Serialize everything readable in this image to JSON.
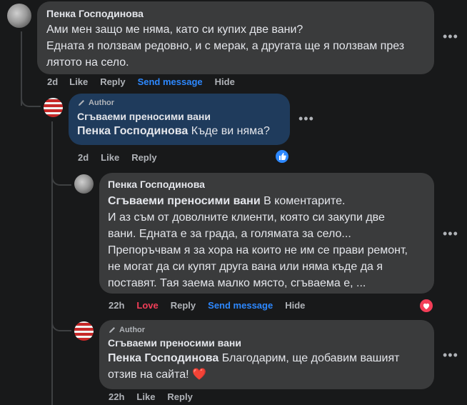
{
  "comment1": {
    "author": "Пенка Господинова",
    "line1": "Ами мен защо ме няма, като си купих две вани?",
    "line2": "Едната я ползвам редовно, и с мерак, а другата ще я ползвам през",
    "line3": "лятото на село.",
    "time": "2d",
    "like": "Like",
    "reply": "Reply",
    "send": "Send message",
    "hide": "Hide"
  },
  "reply1": {
    "badge": "Author",
    "page": "Сгъваеми преносими вани",
    "mention": "Пенка Господинова",
    "text": " Къде ви няма?",
    "time": "2d",
    "like": "Like",
    "reply": "Reply"
  },
  "reply2": {
    "author": "Пенка Господинова",
    "mention": "Сгъваеми преносими вани",
    "line1": " В коментарите.",
    "line2": "И аз съм от доволните клиенти, която си закупи две",
    "line3": "вани. Едната е за града, а голямата за село...",
    "line4": "Препоръчвам я за хора на които не им се прави ремонт,",
    "line5": "не могат да си купят друга вана или няма къде да я",
    "line6": "поставят. Тая заема малко място, сгъваема е, ...",
    "time": "22h",
    "love": "Love",
    "reply": "Reply",
    "send": "Send message",
    "hide": "Hide"
  },
  "reply3": {
    "badge": "Author",
    "page": "Сгъваеми преносими вани",
    "mention": "Пенка Господинова",
    "line1": " Благодарим, ще добавим вашият",
    "line2": "отзив на сайта! ",
    "heart": "❤️",
    "time": "22h",
    "like": "Like",
    "reply": "Reply"
  },
  "icons": {
    "more": "more-options-icon",
    "like_reaction": "like-reaction-icon",
    "love_reaction": "love-reaction-icon",
    "pencil": "pencil-icon"
  },
  "colors": {
    "background": "#18191a",
    "bubble": "#3a3b3c",
    "author_bubble": "#1f3b5c",
    "link": "#2d88ff",
    "love": "#f33e58"
  }
}
